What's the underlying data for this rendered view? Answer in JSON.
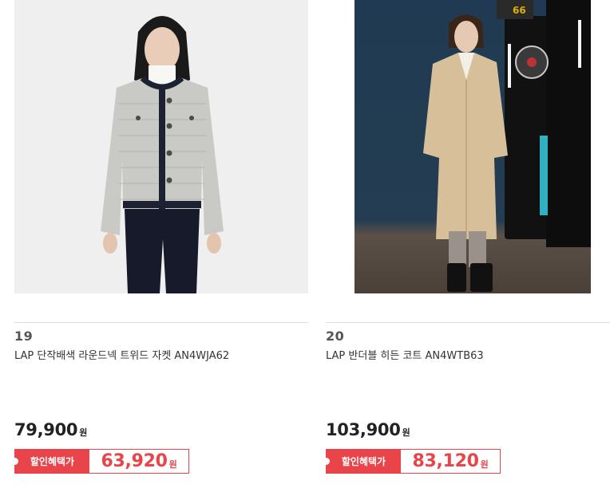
{
  "products": [
    {
      "rank": "19",
      "title": "LAP 단작배색 라운드넥 트위드 자켓 AN4WJA62",
      "price": "79,900",
      "currency": "원",
      "sale_label": "할인혜택가",
      "sale_price": "63,920",
      "image": "woman-in-tweed-jacket-photo"
    },
    {
      "rank": "20",
      "title": "LAP 반더블 히든 코트 AN4WTB63",
      "price": "103,900",
      "currency": "원",
      "sale_label": "할인혜택가",
      "sale_price": "83,120",
      "image": "woman-in-beige-coat-arcade-photo"
    }
  ],
  "colors": {
    "sale_accent": "#e8444a",
    "divider": "#dcdcdc"
  },
  "arcade_score_display": "66"
}
